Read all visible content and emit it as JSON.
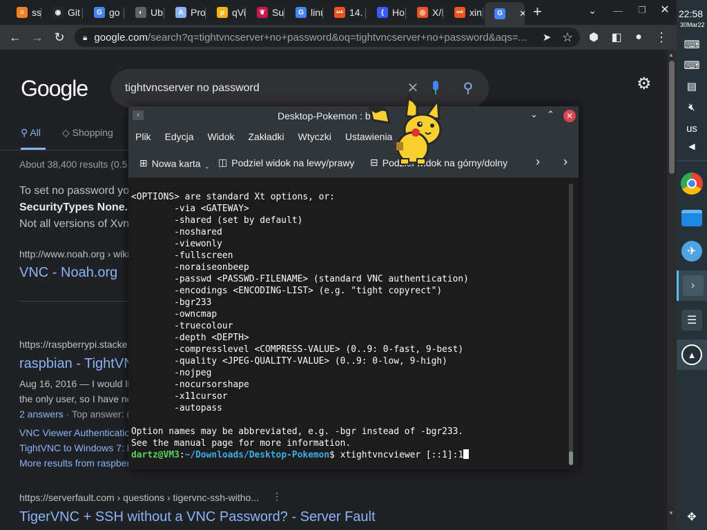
{
  "tabs": [
    {
      "label": "ssl",
      "icon": "stackoverflow-icon",
      "color": "#f48024",
      "glyph": "≡"
    },
    {
      "label": "Git",
      "icon": "github-icon",
      "color": "#24292e",
      "glyph": "◉"
    },
    {
      "label": "go",
      "icon": "google-icon",
      "color": "#4285f4",
      "glyph": "G"
    },
    {
      "label": "Ub",
      "icon": "globe-icon",
      "color": "#5f6368",
      "glyph": "◐"
    },
    {
      "label": "Pro",
      "icon": "a-icon",
      "color": "#8ab4f8",
      "glyph": "A"
    },
    {
      "label": "qVi",
      "icon": "qvi-icon",
      "color": "#f6b40e",
      "glyph": "p"
    },
    {
      "label": "Sup",
      "icon": "raspberry-icon",
      "color": "#c51a4a",
      "glyph": "❦"
    },
    {
      "label": "linu",
      "icon": "google-icon",
      "color": "#4285f4",
      "glyph": "G"
    },
    {
      "label": "14.",
      "icon": "askubuntu-icon",
      "color": "#e95420",
      "glyph": "ask"
    },
    {
      "label": "Ho",
      "icon": "bracket-icon",
      "color": "#3d5afe",
      "glyph": "{"
    },
    {
      "label": "X/I",
      "icon": "ubuntu-icon",
      "color": "#e95420",
      "glyph": "◎"
    },
    {
      "label": "xin",
      "icon": "askubuntu-icon",
      "color": "#e95420",
      "glyph": "ask"
    },
    {
      "label": "",
      "icon": "google-icon",
      "color": "#4285f4",
      "glyph": "G",
      "active": true
    }
  ],
  "url": {
    "host": "google.com",
    "path": "/search?q=tightvncserver+no+password&oq=tightvncserver+no+password&aqs=..."
  },
  "google": {
    "logo": "Google",
    "query": "tightvncserver no password",
    "tab_all": "All",
    "tab_shopping": "Shopping",
    "result_count": "About 38,400 results (0.5",
    "snippet_line1": "To set no password yo",
    "snippet_line2": "SecurityTypes None. T",
    "snippet_line3": "Not all versions of Xvn",
    "r1_url": "http://www.noah.org › wiki",
    "r1_title": "VNC - Noah.org",
    "r2_url": "https://raspberrypi.stacke",
    "r2_title": "raspbian - TightVN",
    "r2_line1": "Aug 16, 2016 — I would li",
    "r2_line2": "the only user, so I have no",
    "r2_answers": "2 answers",
    "r2_top": "· Top answer: (",
    "r2_link1": "VNC Viewer Authenticatio",
    "r2_link2": "TightVNC to Windows 7: b",
    "r2_more": "More results from raspber",
    "r3_url": "https://serverfault.com › questions › tigervnc-ssh-witho...",
    "r3_title": "TigerVNC + SSH without a VNC Password? - Server Fault"
  },
  "shelf": {
    "time": "22:58",
    "date": "30Mar22",
    "kbd": "us"
  },
  "terminal": {
    "title": "Desktop-Pokemon : b",
    "menu": [
      "Plik",
      "Edycja",
      "Widok",
      "Zakładki",
      "Wtyczki",
      "Ustawienia"
    ],
    "new_tab": "Nowa karta",
    "split_lr": "Podziel widok na lewy/prawy",
    "split_tb": "Podziel widok na górny/dolny",
    "output": "<OPTIONS> are standard Xt options, or:\n        -via <GATEWAY>\n        -shared (set by default)\n        -noshared\n        -viewonly\n        -fullscreen\n        -noraiseonbeep\n        -passwd <PASSWD-FILENAME> (standard VNC authentication)\n        -encodings <ENCODING-LIST> (e.g. \"tight copyrect\")\n        -bgr233\n        -owncmap\n        -truecolour\n        -depth <DEPTH>\n        -compresslevel <COMPRESS-VALUE> (0..9: 0-fast, 9-best)\n        -quality <JPEG-QUALITY-VALUE> (0..9: 0-low, 9-high)\n        -nojpeg\n        -nocursorshape\n        -x11cursor\n        -autopass\n\nOption names may be abbreviated, e.g. -bgr instead of -bgr233.\nSee the manual page for more information.",
    "prompt_user": "dartz@VM3",
    "prompt_sep": ":",
    "prompt_path": "~/Downloads/Desktop-Pokemon",
    "prompt_end": "$ ",
    "command": "xtightvncviewer [::1]:1"
  }
}
